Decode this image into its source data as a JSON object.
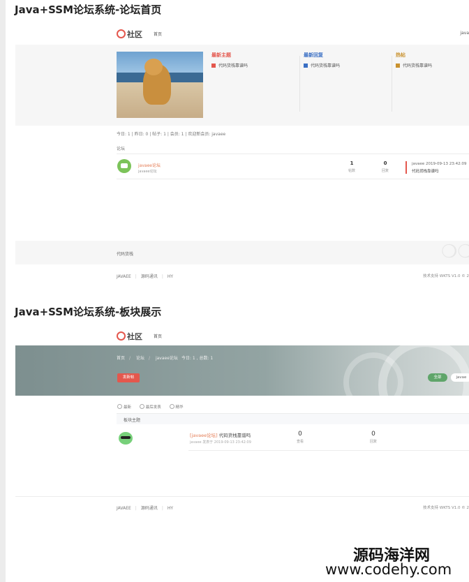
{
  "section1": {
    "heading": "Java+SSM论坛系统-论坛首页",
    "logo": "社区",
    "nav_home": "首页",
    "nav_right": "java",
    "columns": [
      {
        "title": "最新主题",
        "item": "代码货栈靠谱吗",
        "color": "#e4574d",
        "icon": "red-square-icon"
      },
      {
        "title": "最新回复",
        "item": "代码货栈靠谱吗",
        "color": "#3a6fc4",
        "icon": "blue-square-icon"
      },
      {
        "title": "热帖",
        "item": "代码货栈靠谱吗",
        "color": "#c9922f",
        "icon": "gold-square-icon"
      }
    ],
    "stats": "今日: 1  |  昨日: 0  |  帖子: 1  |  会员: 1  |  欢迎新会员: javaee",
    "section_label": "论坛",
    "forum": {
      "name": "javaee论坛",
      "desc": "javaee论坛",
      "posts": "1",
      "posts_label": "帖数",
      "replies": "0",
      "replies_label": "回复",
      "last_user": "javaee 2019-09-13 23:42:09",
      "last_topic": "代码货栈靠谱吗"
    },
    "gray_footer_text": "代码货栈",
    "footer_links": [
      "JAVAEE",
      "|",
      "源码通讯",
      "|",
      "HY"
    ],
    "footer_right": "技术支持 WKTS V1.0 © 2"
  },
  "section2": {
    "heading": "Java+SSM论坛系统-板块展示",
    "logo": "社区",
    "nav_home": "首页",
    "crumbs": [
      "首页",
      "论坛",
      "javaee论坛"
    ],
    "banner_stats": "今日: 1 , 总数: 1",
    "post_button": "发新帖",
    "all_button": "全部",
    "more_button": "javae",
    "filters": [
      "最新",
      "最后发表",
      "精华"
    ],
    "table_header": "板块主题",
    "topic": {
      "tag": "[javaee论坛]",
      "title": "代码货栈靠谱吗",
      "meta": "javaee 发表于 2019-09-13 23:42:09",
      "views": "0",
      "views_label": "查看",
      "replies": "0",
      "replies_label": "回复"
    },
    "footer_links": [
      "JAVAEE",
      "|",
      "源码通讯",
      "|",
      "HY"
    ],
    "footer_right": "技术支持 WKTS V1.0 © 2"
  },
  "watermark": {
    "line1": "源码海洋网",
    "line2": "www.codehy.com"
  }
}
